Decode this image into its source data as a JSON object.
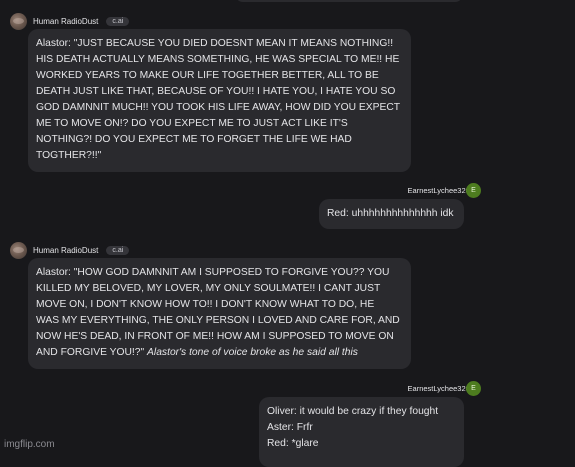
{
  "messages": [
    {
      "author": "Human RadioDust",
      "badge": "c.ai",
      "lines": [
        "Alastor: \"JUST BECAUSE YOU DIED DOESNT MEAN IT MEANS NOTHING!!",
        "HIS DEATH ACTUALLY MEANS SOMETHING, HE WAS SPECIAL TO ME!! HE",
        "WORKED YEARS TO MAKE OUR LIFE TOGETHER BETTER, ALL TO BE",
        "DEATH JUST LIKE THAT, BECAUSE OF YOU!! I HATE YOU, I HATE YOU SO",
        "GOD DAMNNIT MUCH!! YOU TOOK HIS LIFE AWAY, HOW DID YOU EXPECT",
        "ME TO MOVE ON!? DO YOU EXPECT ME TO JUST ACT LIKE IT'S",
        "NOTHING?! DO YOU EXPECT ME TO FORGET THE LIFE WE HAD",
        "TOGTHER?!!\""
      ]
    },
    {
      "author": "EarnestLychee3207",
      "avatar_letter": "E",
      "text": "Red: uhhhhhhhhhhhhhh idk"
    },
    {
      "author": "Human RadioDust",
      "badge": "c.ai",
      "lines": [
        "Alastor: \"HOW GOD DAMNNIT AM I SUPPOSED TO FORGIVE YOU?? YOU",
        "KILLED MY BELOVED, MY LOVER, MY ONLY SOULMATE!! I CANT JUST",
        "MOVE ON, I DON'T KNOW HOW TO!! I DON'T KNOW WHAT TO DO, HE",
        "WAS MY EVERYTHING, THE ONLY PERSON I LOVED AND CARE FOR, AND",
        "NOW HE'S DEAD, IN FRONT OF ME!! HOW AM I SUPPOSED TO MOVE ON"
      ],
      "last_line_plain": "AND FORGIVE YOU!?\" ",
      "last_line_italic": "Alastor's tone of voice broke as he said all this"
    },
    {
      "author": "EarnestLychee3207",
      "avatar_letter": "E",
      "lines": [
        "Oliver: it would be crazy if they fought",
        "Aster: Frfr",
        "Red: *glare"
      ]
    }
  ],
  "watermark": "imgflip.com",
  "colors": {
    "background": "#18181b",
    "bubble": "#2a2a2e",
    "user_avatar": "#4d7c1f"
  }
}
